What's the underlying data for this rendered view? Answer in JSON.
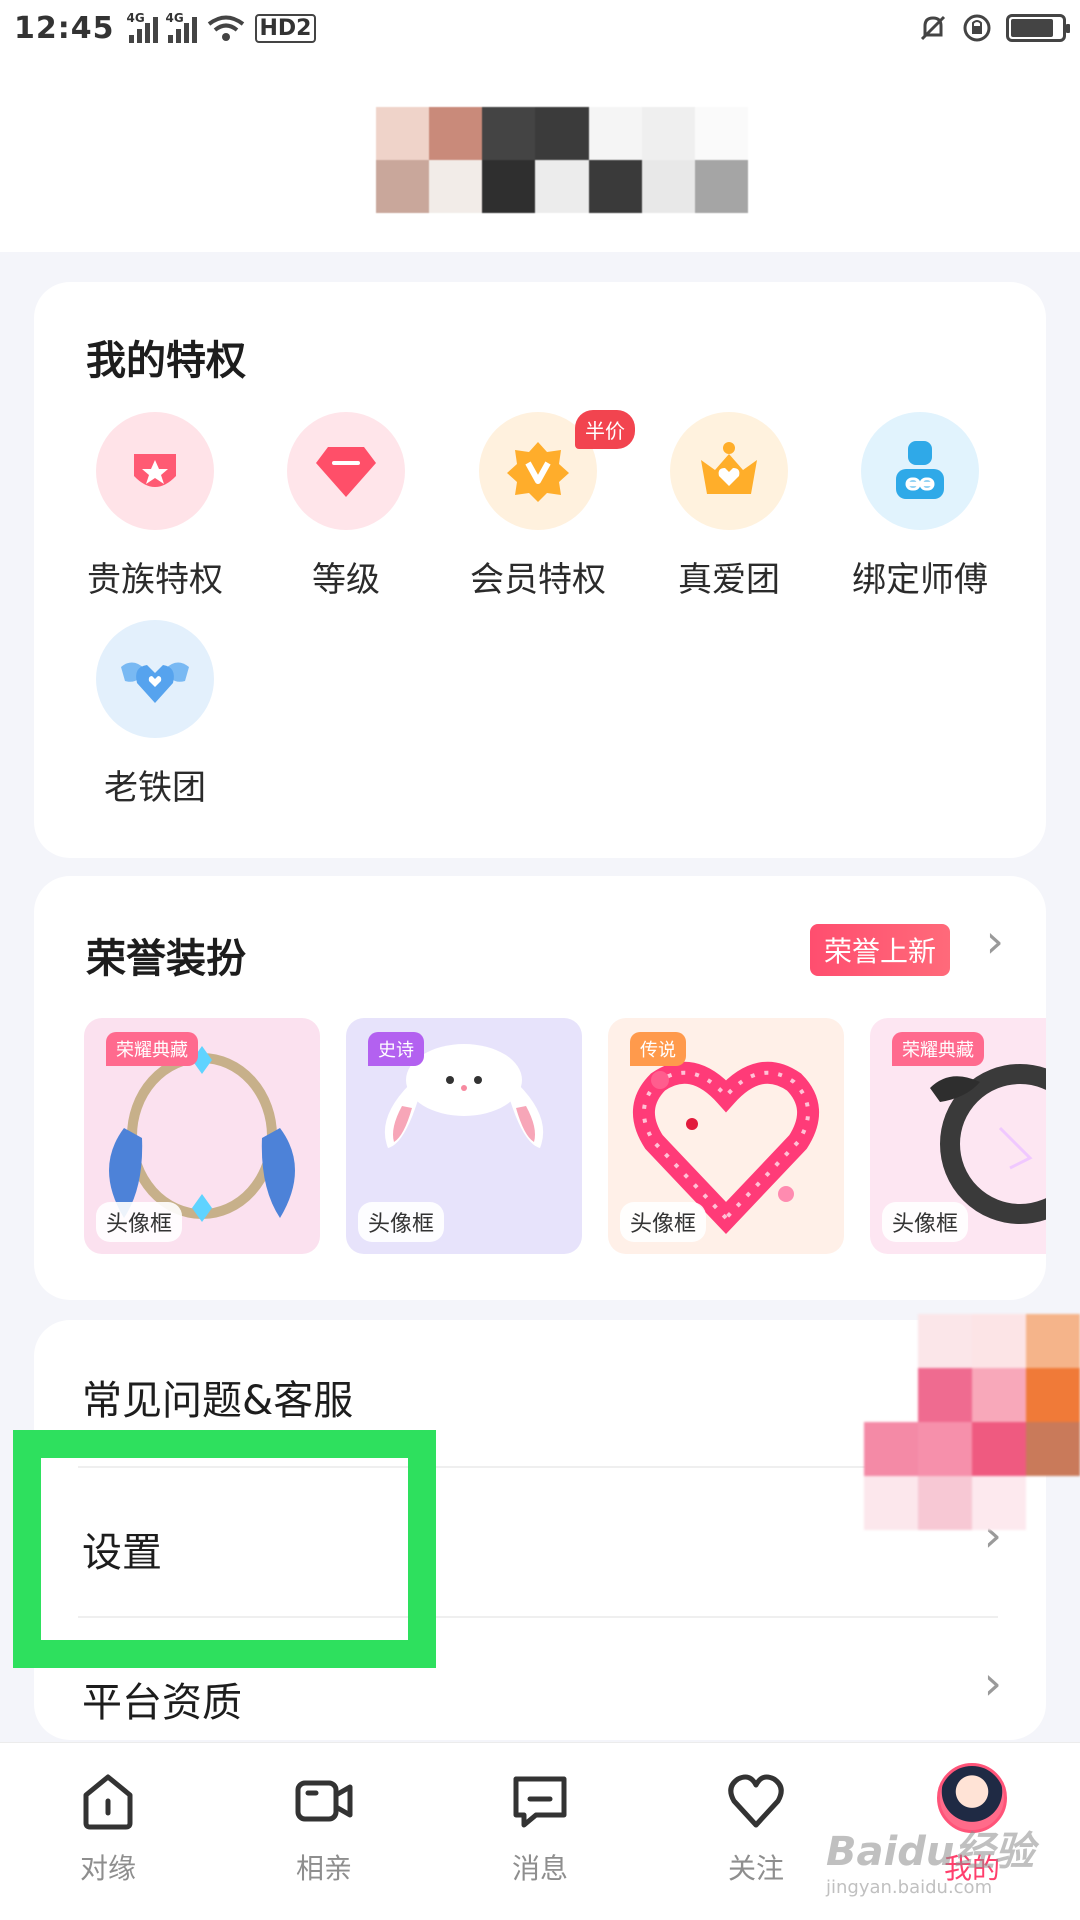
{
  "status_bar": {
    "time": "12:45",
    "network_1": "4G",
    "network_2": "4G",
    "hd": "HD2"
  },
  "privileges": {
    "title": "我的特权",
    "items": [
      {
        "label": "贵族特权",
        "icon": "noble-badge-icon",
        "color": "#ff5a73",
        "bg": "#ffe3e8"
      },
      {
        "label": "等级",
        "icon": "diamond-icon",
        "color": "#ff4f69",
        "bg": "#ffe5ea"
      },
      {
        "label": "会员特权",
        "icon": "vip-v-badge-icon",
        "color": "#ffad2b",
        "bg": "#fff1de",
        "badge": "半价"
      },
      {
        "label": "真爱团",
        "icon": "heart-crown-icon",
        "color": "#ffae2a",
        "bg": "#fff2de"
      },
      {
        "label": "绑定师傅",
        "icon": "link-user-icon",
        "color": "#2fa9e8",
        "bg": "#e1f3fd"
      },
      {
        "label": "老铁团",
        "icon": "winged-heart-icon",
        "color": "#56a3ee",
        "bg": "#e3f0fc"
      }
    ]
  },
  "honor": {
    "title": "荣誉装扮",
    "new_tag": "荣誉上新",
    "frames": [
      {
        "tag": "荣耀典藏",
        "kind": "头像框",
        "tag_color": "#ff6a8e",
        "bg": "#fbe1ef"
      },
      {
        "tag": "史诗",
        "kind": "头像框",
        "tag_color": "#b361f0",
        "bg": "#e7e3fb"
      },
      {
        "tag": "传说",
        "kind": "头像框",
        "tag_color": "#ff9a4c",
        "bg": "#fff0e8"
      },
      {
        "tag": "荣耀典藏",
        "kind": "头像框",
        "tag_color": "#ff6a8e",
        "bg": "#fde6f2"
      }
    ]
  },
  "menu": {
    "faq": "常见问题&客服",
    "settings": "设置",
    "platform": "平台资质"
  },
  "tabbar": {
    "items": [
      {
        "label": "对缘",
        "icon": "home-icon"
      },
      {
        "label": "相亲",
        "icon": "video-camera-icon"
      },
      {
        "label": "消息",
        "icon": "message-icon"
      },
      {
        "label": "关注",
        "icon": "heart-icon"
      },
      {
        "label": "我的",
        "icon": "avatar-icon",
        "active": true
      }
    ]
  },
  "watermark": {
    "brand": "Baidu经验",
    "url": "jingyan.baidu.com"
  },
  "colors": {
    "accent": "#ff3f6c",
    "highlight_box": "#2ee05e"
  }
}
